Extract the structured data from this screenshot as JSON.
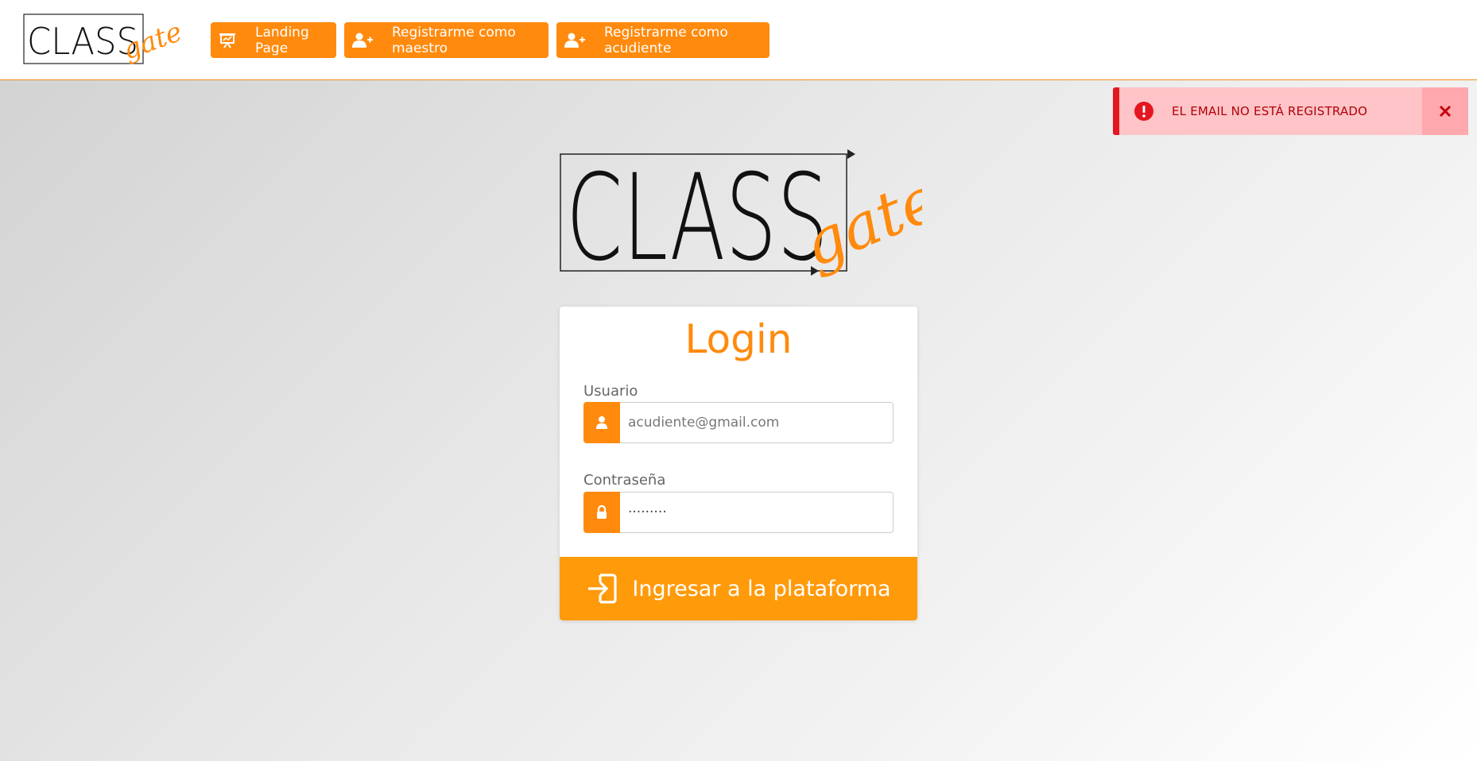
{
  "brand": {
    "name_main": "CLASS",
    "name_script": "gate",
    "colors": {
      "accent": "#ff8a0d",
      "error": "#e4161f"
    }
  },
  "nav": {
    "landing_label": "Landing Page",
    "maestro_label": "Registrarme como maestro",
    "acudiente_label": "Registrarme como acudiente"
  },
  "alert": {
    "message": "EL EMAIL NO ESTÁ REGISTRADO",
    "icon": "exclamation-circle-icon",
    "close_icon": "close-icon"
  },
  "login": {
    "title": "Login",
    "user_label": "Usuario",
    "user_placeholder": "acudiente@gmail.com",
    "user_value": "",
    "password_label": "Contraseña",
    "password_value": "·········",
    "submit_label": "Ingresar a la plataforma"
  }
}
